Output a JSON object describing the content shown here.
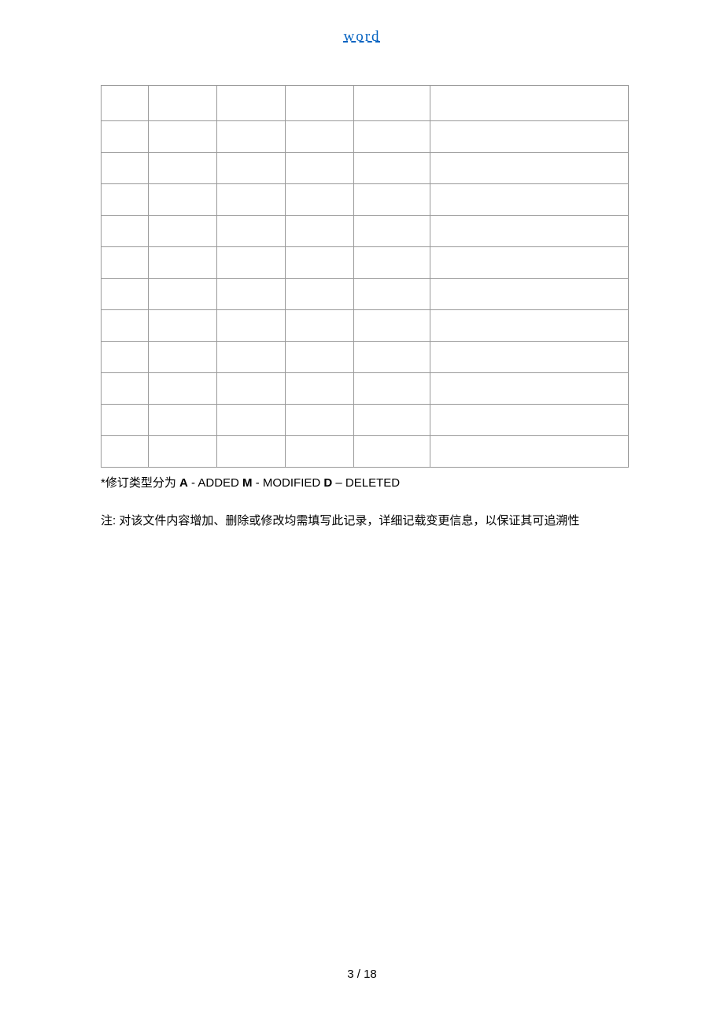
{
  "header": {
    "link_text": "word"
  },
  "table": {
    "rows": 12,
    "columns": 6
  },
  "notes": {
    "revision_prefix": "*修订类型分为 ",
    "a_bold": "A",
    "a_text": " - ADDED   ",
    "m_bold": "M",
    "m_text": " - MODIFIED   ",
    "d_bold": "D",
    "d_text": " – DELETED",
    "instruction": "注: 对该文件内容增加、删除或修改均需填写此记录，详细记载变更信息，以保证其可追溯性"
  },
  "footer": {
    "page": "3 / 18"
  }
}
